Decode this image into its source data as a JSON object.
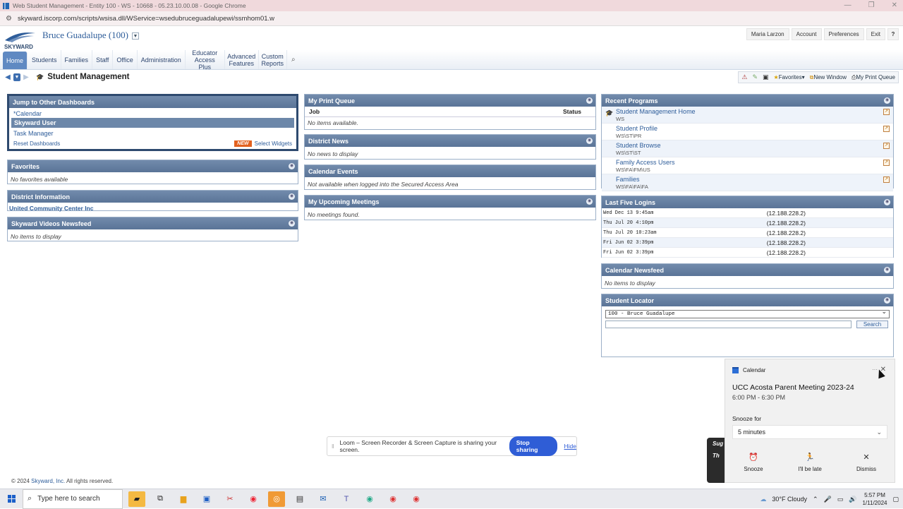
{
  "browser": {
    "title": "Web Student Management - Entity 100 - WS - 10668 - 05.23.10.00.08 - Google Chrome",
    "url": "skyward.iscorp.com/scripts/wsisa.dll/WService=wsedubruceguadalupewi/ssmhom01.w"
  },
  "header": {
    "logo_text": "SKYWARD",
    "entity": "Bruce Guadalupe (100)",
    "user": "Maria Larzon",
    "links": [
      "Account",
      "Preferences",
      "Exit",
      "?"
    ]
  },
  "nav": {
    "tabs": [
      {
        "label": "Home",
        "active": true
      },
      {
        "label": "Students"
      },
      {
        "label": "Families"
      },
      {
        "label": "Staff"
      },
      {
        "label": "Office"
      },
      {
        "label": "Administration"
      },
      {
        "label": "Educator Access Plus"
      },
      {
        "label": "Advanced Features"
      },
      {
        "label": "Custom Reports"
      }
    ]
  },
  "page": {
    "title": "Student Management",
    "tools": {
      "favorites": "Favorites",
      "new_window": "New Window",
      "print_queue": "My Print Queue"
    }
  },
  "jump": {
    "title": "Jump to Other Dashboards",
    "items": [
      "*Calendar",
      "Skyward User",
      "Task Manager"
    ],
    "reset": "Reset Dashboards",
    "new_badge": "NEW",
    "select_widgets": "Select Widgets"
  },
  "favorites": {
    "title": "Favorites",
    "empty": "No favorites available"
  },
  "district_info": {
    "title": "District Information",
    "value": "United Community Center Inc"
  },
  "videos": {
    "title": "Skyward Videos Newsfeed",
    "empty": "No items to display"
  },
  "print_queue": {
    "title": "My Print Queue",
    "col_job": "Job",
    "col_status": "Status",
    "empty": "No items available."
  },
  "district_news": {
    "title": "District News",
    "empty": "No news to display"
  },
  "calendar_events": {
    "title": "Calendar Events",
    "empty": "Not available when logged into the Secured Access Area"
  },
  "meetings": {
    "title": "My Upcoming Meetings",
    "empty": "No meetings found."
  },
  "recent": {
    "title": "Recent Programs",
    "items": [
      {
        "title": "Student Management Home",
        "code": "WS"
      },
      {
        "title": "Student Profile",
        "code": "WS\\ST\\PR"
      },
      {
        "title": "Student Browse",
        "code": "WS\\ST\\ST"
      },
      {
        "title": "Family Access Users",
        "code": "WS\\FA\\FM\\US"
      },
      {
        "title": "Families",
        "code": "WS\\FA\\FA\\FA"
      }
    ]
  },
  "logins": {
    "title": "Last Five Logins",
    "rows": [
      {
        "time": "Wed Dec 13  9:45am",
        "ip": "(12.188.228.2)"
      },
      {
        "time": "Thu Jul 20  4:10pm",
        "ip": "(12.188.228.2)"
      },
      {
        "time": "Thu Jul 20 10:23am",
        "ip": "(12.188.228.2)"
      },
      {
        "time": "Fri Jun 02  3:39pm",
        "ip": "(12.188.228.2)"
      },
      {
        "time": "Fri Jun 02  3:39pm",
        "ip": "(12.188.228.2)"
      }
    ]
  },
  "cal_newsfeed": {
    "title": "Calendar Newsfeed",
    "empty": "No items to display"
  },
  "locator": {
    "title": "Student Locator",
    "selected": "100 - Bruce Guadalupe",
    "search": "Search"
  },
  "footer": {
    "copyright_pre": "© 2024",
    "brand": "Skyward, Inc.",
    "copyright_post": "All rights reserved."
  },
  "loom": {
    "message": "Loom – Screen Recorder & Screen Capture is sharing your screen.",
    "stop": "Stop sharing",
    "hide": "Hide"
  },
  "suggestion": {
    "text": "Sug",
    "text2": "Th"
  },
  "toast": {
    "app": "Calendar",
    "event": "UCC Acosta Parent Meeting 2023-24",
    "time": "6:00 PM - 6:30 PM",
    "snooze_label": "Snooze for",
    "snooze_value": "5 minutes",
    "actions": [
      "Snooze",
      "I'll be late",
      "Dismiss"
    ]
  },
  "taskbar": {
    "search_placeholder": "Type here to search",
    "weather": "30°F  Cloudy",
    "time": "5:57 PM",
    "date": "1/11/2024"
  }
}
